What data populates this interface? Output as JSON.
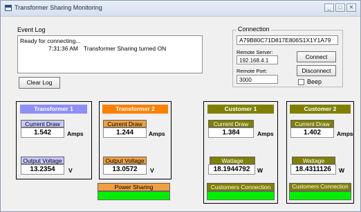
{
  "window": {
    "title": "Transformer Sharing Monitoring",
    "controls": [
      "_",
      "□",
      "✕"
    ]
  },
  "event_log": {
    "label": "Event Log",
    "lines": [
      {
        "time": "",
        "text": "Ready for connecting..."
      },
      {
        "time": "7:31:36 AM",
        "text": "Transformer Sharing turned ON"
      }
    ],
    "clear_button": "Clear Log"
  },
  "connection": {
    "label": "Connection",
    "id_value": "A79B80C71D817E806S1X1Y1A79",
    "remote_server_label": "Remote Server:",
    "remote_server_value": "192.168.4.1",
    "remote_port_label": "Remote Port:",
    "remote_port_value": "3000",
    "connect_button": "Connect",
    "disconnect_button": "Disconnect",
    "beep_label": "Beep"
  },
  "colors": {
    "transformer1": "#8f8ff8",
    "transformer2": "#ff8000",
    "transformer2_label": "#f0a040",
    "customer": "#808000",
    "indicator_on": "#00f000"
  },
  "transformer1": {
    "title": "Transformer 1",
    "current_label": "Current Draw",
    "current_value": "1.542",
    "current_unit": "Amps",
    "voltage_label": "Output Voltage",
    "voltage_value": "13.2354",
    "voltage_unit": "V"
  },
  "transformer2": {
    "title": "Transformer 2",
    "current_label": "Current Draw",
    "current_value": "1.244",
    "current_unit": "Amps",
    "voltage_label": "Output Voltage",
    "voltage_value": "13.0572",
    "voltage_unit": "V"
  },
  "power_sharing": {
    "label": "Power Sharing"
  },
  "customer1": {
    "title": "Customer 1",
    "current_label": "Current Draw",
    "current_value": "1.384",
    "current_unit": "Amps",
    "wattage_label": "Wattage",
    "wattage_value": "18.1944792",
    "wattage_unit": "W",
    "connection_label": "Customers Connection"
  },
  "customer2": {
    "title": "Customer 2",
    "current_label": "Current Draw",
    "current_value": "1.402",
    "current_unit": "Amps",
    "wattage_label": "Wattage",
    "wattage_value": "18.4311126",
    "wattage_unit": "W",
    "connection_label": "Customers Connection"
  }
}
